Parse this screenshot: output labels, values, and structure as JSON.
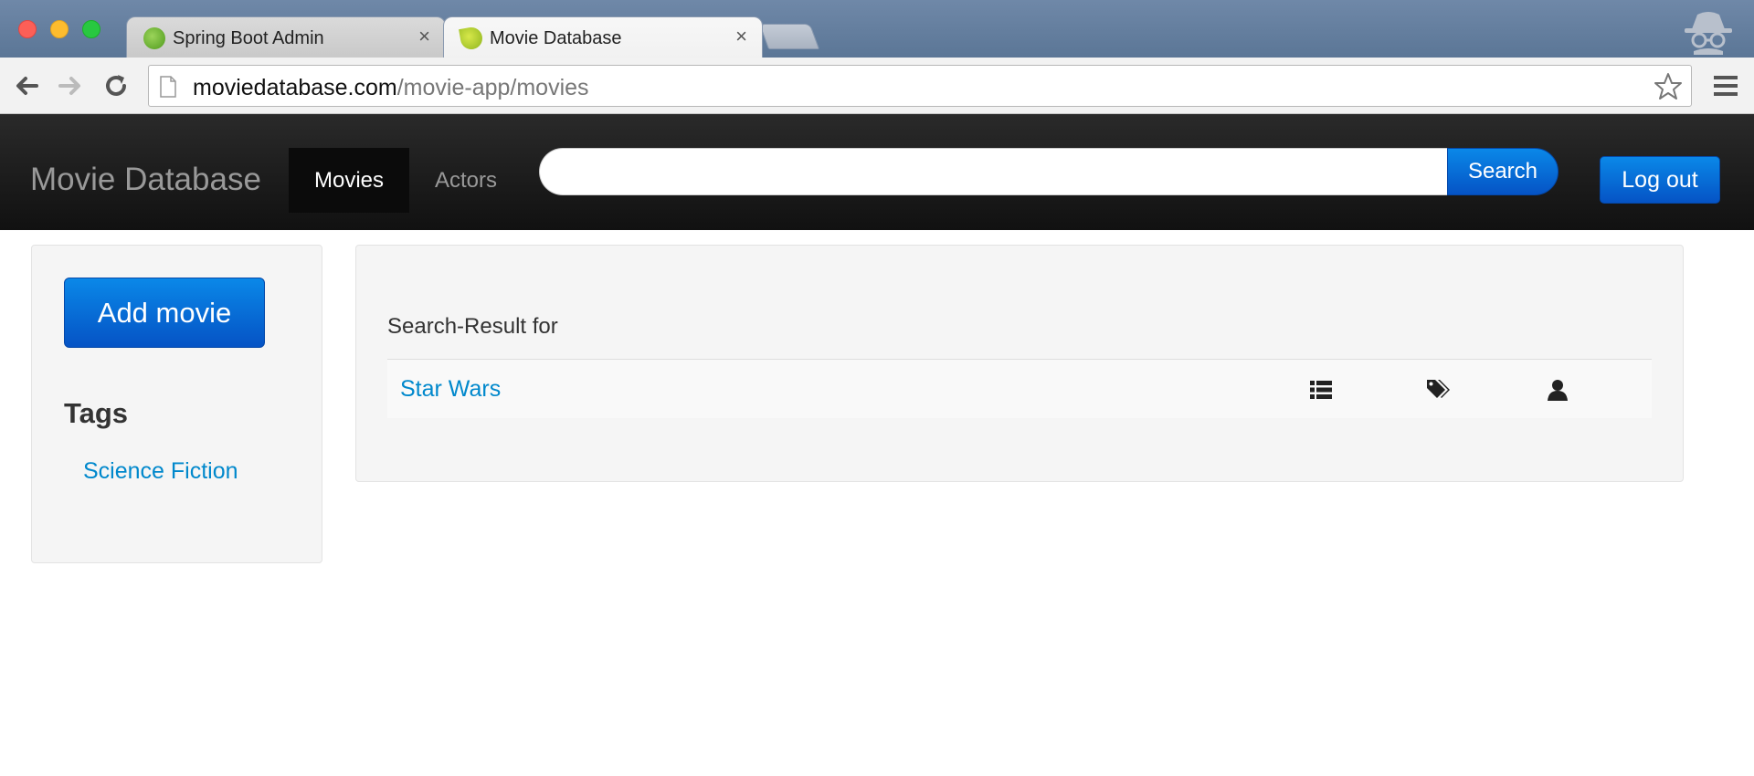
{
  "browser": {
    "tabs": [
      {
        "title": "Spring Boot Admin",
        "close": "×"
      },
      {
        "title": "Movie Database",
        "close": "×"
      }
    ],
    "url": {
      "host": "moviedatabase.com",
      "path": "/movie-app/movies"
    }
  },
  "navbar": {
    "brand": "Movie Database",
    "movies_label": "Movies",
    "actors_label": "Actors",
    "search_value": "",
    "search_button": "Search",
    "logout_button": "Log out"
  },
  "sidebar": {
    "add_movie_button": "Add movie",
    "tags_heading": "Tags",
    "tags": [
      "Science Fiction"
    ]
  },
  "main": {
    "heading": "Search-Result for",
    "results": [
      {
        "title": "Star Wars",
        "icons": [
          "list-icon",
          "tags-icon",
          "user-icon"
        ]
      }
    ]
  },
  "colors": {
    "link": "#0088cc",
    "primary_button": "#0553c5",
    "navbar": "#1b1b1b"
  }
}
